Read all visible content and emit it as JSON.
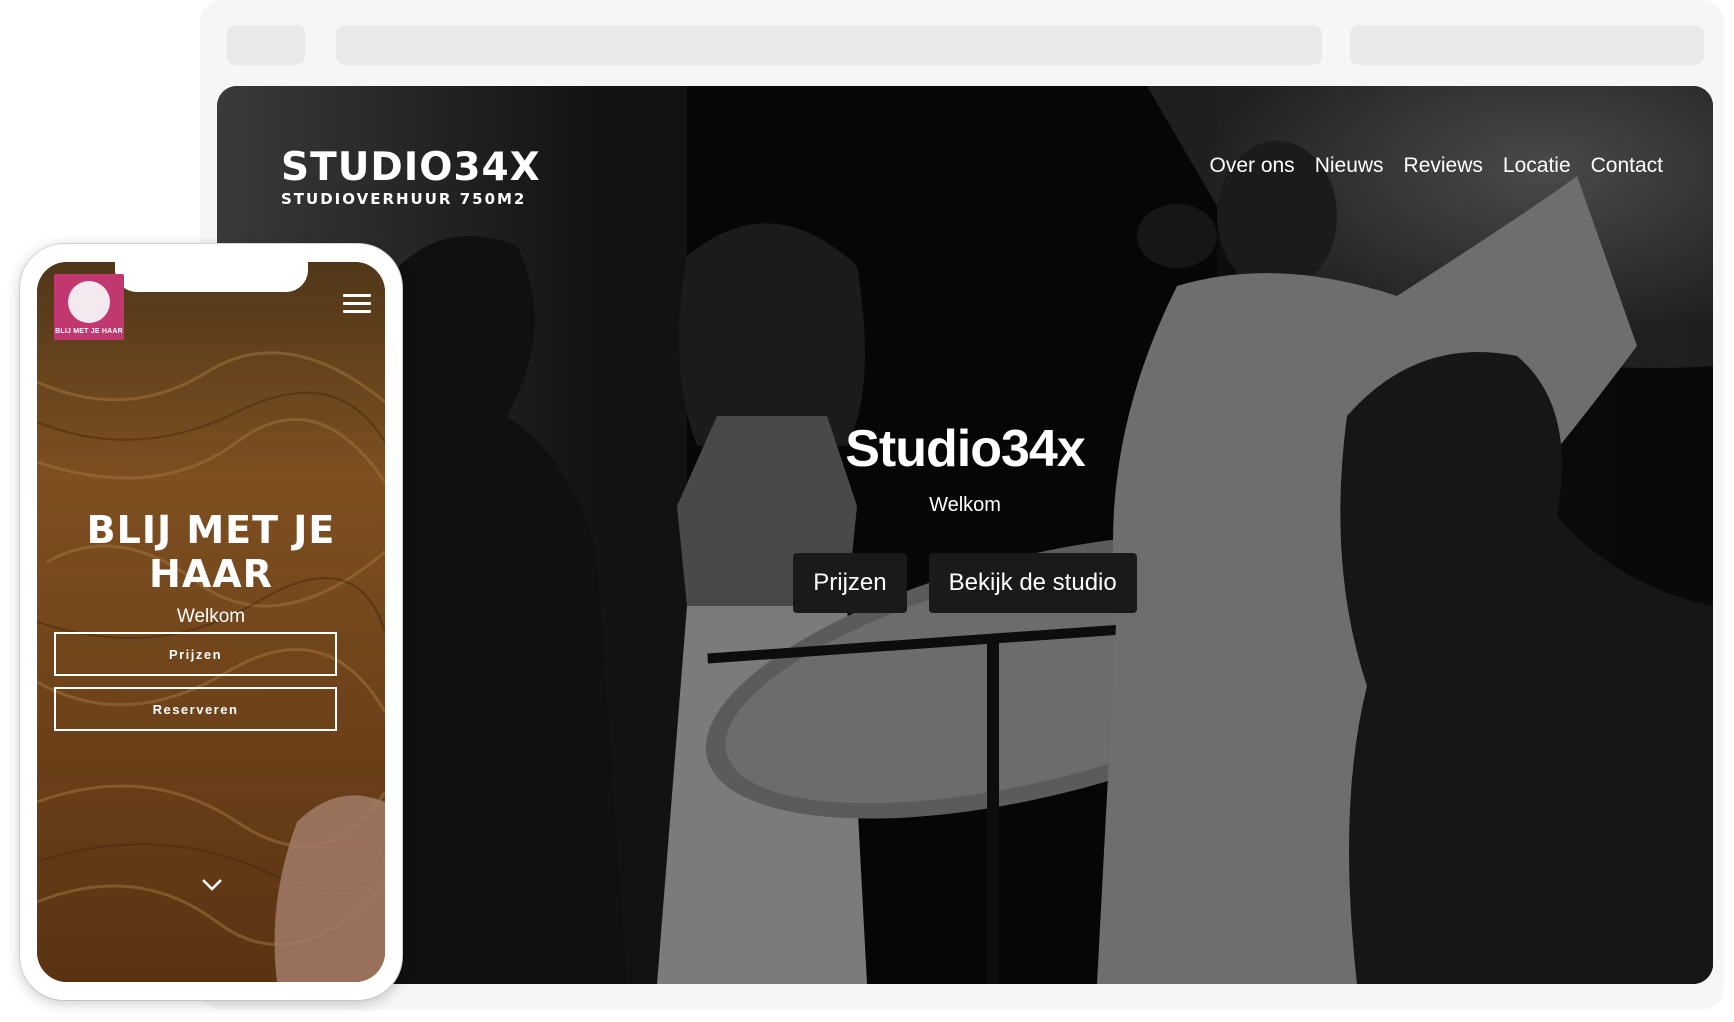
{
  "desktop": {
    "logo": {
      "main": "STUDIO34X",
      "sub": "STUDIOVERHUUR 750M2"
    },
    "nav": [
      "Over ons",
      "Nieuws",
      "Reviews",
      "Locatie",
      "Contact"
    ],
    "hero": {
      "title": "Studio34x",
      "subtitle": "Welkom",
      "buttons": [
        "Prijzen",
        "Bekijk de studio"
      ]
    }
  },
  "mobile": {
    "logo_text": "BLIJ MET JE HAAR",
    "hero": {
      "title_line1": "BLIJ MET JE",
      "title_line2": "HAAR",
      "subtitle": "Welkom",
      "buttons": [
        "Prijzen",
        "Reserveren"
      ]
    },
    "accent_color": "#c0386f"
  }
}
